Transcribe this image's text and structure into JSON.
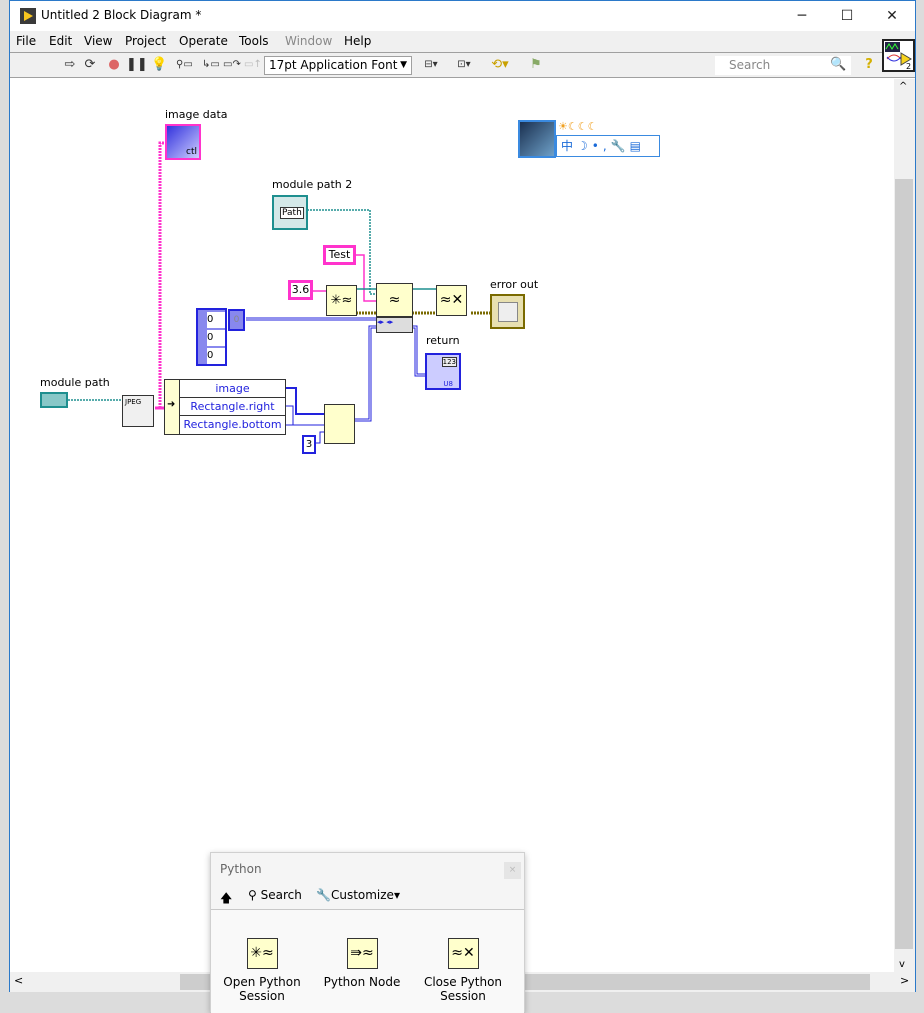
{
  "window": {
    "title": "Untitled 2 Block Diagram *",
    "minimize": "─",
    "maximize": "☐",
    "close": "✕"
  },
  "menu": [
    "File",
    "Edit",
    "View",
    "Project",
    "Operate",
    "Tools",
    "Window",
    "Help"
  ],
  "toolbar": {
    "font_select": "17pt Application Font",
    "search_placeholder": "Search",
    "help": "?"
  },
  "diagram": {
    "labels": {
      "image_data": "image data",
      "module_path_2": "module path 2",
      "module_path": "module path",
      "error_out": "error out",
      "return": "return"
    },
    "constants": {
      "test_string": "Test",
      "number": "3.6",
      "array_values": [
        "0",
        "0",
        "0"
      ],
      "array_index": "0",
      "three": "3",
      "path_text": "Path",
      "jpeg": "JPEG"
    },
    "unbundle_fields": [
      "image",
      "Rectangle.right",
      "Rectangle.bottom"
    ],
    "return_type": "U8",
    "return_display": "123"
  },
  "ime_bar": {
    "top_icons": "☀☾☾☾",
    "bottom": [
      "中",
      "☽",
      "•,",
      "🔧",
      "▤"
    ]
  },
  "palette": {
    "title": "Python",
    "close": "×",
    "up": "🡅",
    "search": "Search",
    "customize": "Customize▾",
    "items": [
      {
        "label": "Open Python Session",
        "icon": "open-python-session"
      },
      {
        "label": "Python Node",
        "icon": "python-node"
      },
      {
        "label": "Close Python Session",
        "icon": "close-python-session"
      }
    ]
  },
  "scroll": {
    "left": "<",
    "right": ">",
    "up": "^",
    "down": "v"
  }
}
